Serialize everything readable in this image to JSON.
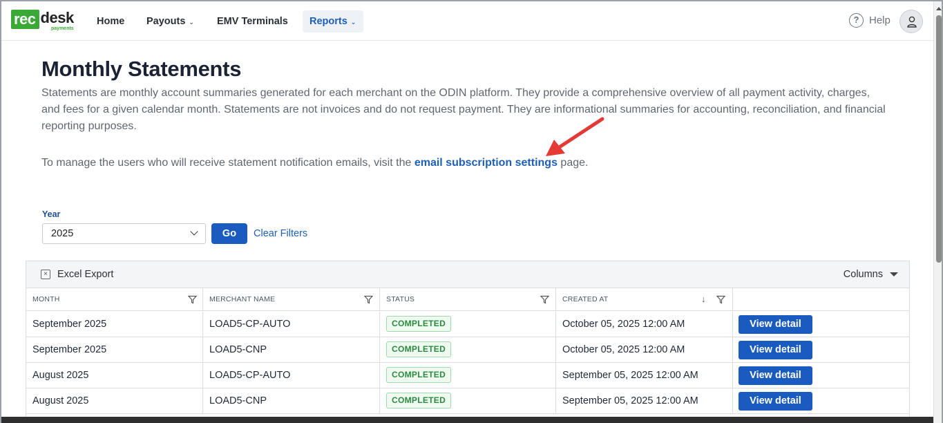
{
  "brand": {
    "rec": "rec",
    "desk": "desk",
    "sub": "payments"
  },
  "nav": {
    "items": [
      {
        "label": "Home",
        "dropdown": false
      },
      {
        "label": "Payouts",
        "dropdown": true
      },
      {
        "label": "EMV Terminals",
        "dropdown": false
      },
      {
        "label": "Reports",
        "dropdown": true,
        "active": true
      }
    ],
    "help_label": "Help"
  },
  "page": {
    "title": "Monthly Statements",
    "description": "Statements are monthly account summaries generated for each merchant on the ODIN platform. They provide a comprehensive overview of all payment activity, charges, and fees for a given calendar month. Statements are not invoices and do not request payment. They are informational summaries for accounting, reconciliation, and financial reporting purposes.",
    "manage_prefix": "To manage the users who will receive statement notification emails, visit the ",
    "manage_link": "email subscription settings",
    "manage_suffix": " page."
  },
  "filters": {
    "year_label": "Year",
    "year_value": "2025",
    "go_label": "Go",
    "clear_label": "Clear Filters"
  },
  "grid": {
    "excel_label": "Excel Export",
    "columns_label": "Columns",
    "headers": [
      "MONTH",
      "MERCHANT NAME",
      "STATUS",
      "CREATED AT"
    ],
    "rows": [
      {
        "month": "September 2025",
        "merchant": "LOAD5-CP-AUTO",
        "status": "COMPLETED",
        "created": "October 05, 2025 12:00 AM",
        "action": "View detail"
      },
      {
        "month": "September 2025",
        "merchant": "LOAD5-CNP",
        "status": "COMPLETED",
        "created": "October 05, 2025 12:00 AM",
        "action": "View detail"
      },
      {
        "month": "August 2025",
        "merchant": "LOAD5-CP-AUTO",
        "status": "COMPLETED",
        "created": "September 05, 2025 12:00 AM",
        "action": "View detail"
      },
      {
        "month": "August 2025",
        "merchant": "LOAD5-CNP",
        "status": "COMPLETED",
        "created": "September 05, 2025 12:00 AM",
        "action": "View detail"
      }
    ]
  },
  "colors": {
    "brand_green": "#3aa935",
    "primary_blue": "#1a5bbf",
    "status_green": "#2b8a3e",
    "annotation_red": "#e53935"
  }
}
